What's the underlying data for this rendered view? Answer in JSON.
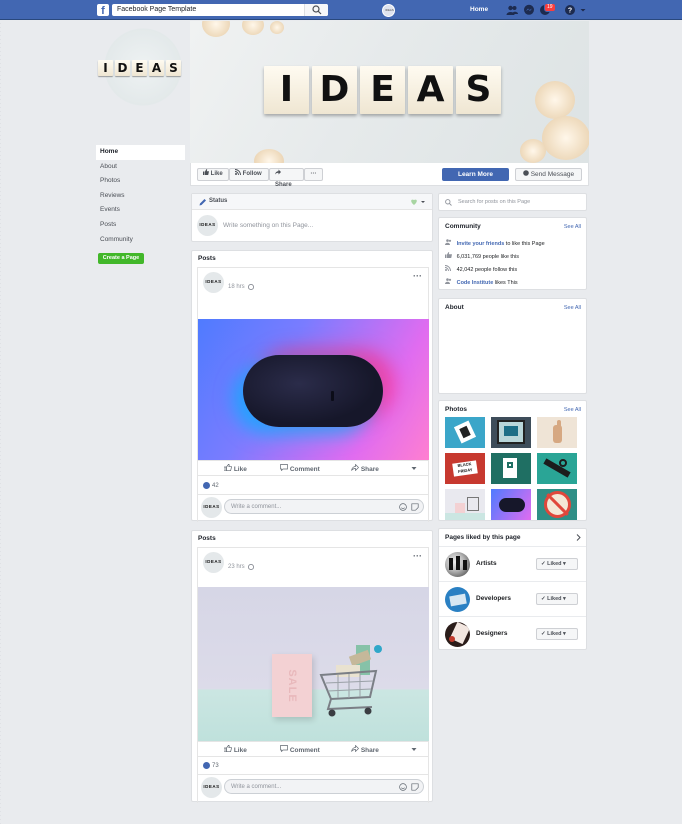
{
  "topbar": {
    "logo": "f",
    "search_value": "Facebook Page Template",
    "avatar_label": "IDEAS",
    "home_label": "Home",
    "notifications_count": "19"
  },
  "page": {
    "avatar_word": [
      "I",
      "D",
      "E",
      "A",
      "S"
    ],
    "cover_word": [
      "I",
      "D",
      "E",
      "A",
      "S"
    ]
  },
  "left_nav": {
    "items": [
      "Home",
      "About",
      "Photos",
      "Reviews",
      "Events",
      "Posts",
      "Community"
    ],
    "create_page": "Create a Page"
  },
  "action_bar": {
    "like": "Like",
    "follow": "Follow",
    "share": "Share",
    "more": "···",
    "learn_more": "Learn More",
    "send_message": "Send Message"
  },
  "composer": {
    "status_label": "Status",
    "placeholder": "Write something on this Page...",
    "avatar_text": "IDEAS"
  },
  "posts": [
    {
      "section_title": "Posts",
      "time": "18 hrs",
      "avatar_text": "IDEAS",
      "like_label": "Like",
      "comment_label": "Comment",
      "share_label": "Share",
      "reactions": "42",
      "comment_placeholder": "Write a comment..."
    },
    {
      "section_title": "Posts",
      "time": "23 hrs",
      "avatar_text": "IDEAS",
      "like_label": "Like",
      "comment_label": "Comment",
      "share_label": "Share",
      "reactions": "73",
      "comment_placeholder": "Write a comment...",
      "sign_text": "SALE"
    }
  ],
  "sidebar": {
    "search_placeholder": "Search for posts on this Page",
    "community": {
      "title": "Community",
      "see_all": "See All",
      "invite_link": "Invite your friends",
      "invite_rest": " to like this Page",
      "likes": "6,031,769 people like this",
      "follows": "42,042 people follow this",
      "ci_link": "Code Institute",
      "ci_rest": " likes This"
    },
    "about": {
      "title": "About",
      "see_all": "See All"
    },
    "photos": {
      "title": "Photos",
      "see_all": "See All",
      "friday_text": "BLACK FRIDAY"
    },
    "liked_pages": {
      "title": "Pages liked by this page",
      "items": [
        {
          "name": "Artists",
          "button": "Liked"
        },
        {
          "name": "Developers",
          "button": "Liked"
        },
        {
          "name": "Designers",
          "button": "Liked"
        }
      ]
    }
  },
  "colors": {
    "brand_blue": "#4267b2",
    "create_green": "#42b72a",
    "badge_red": "#fa3e3e"
  }
}
